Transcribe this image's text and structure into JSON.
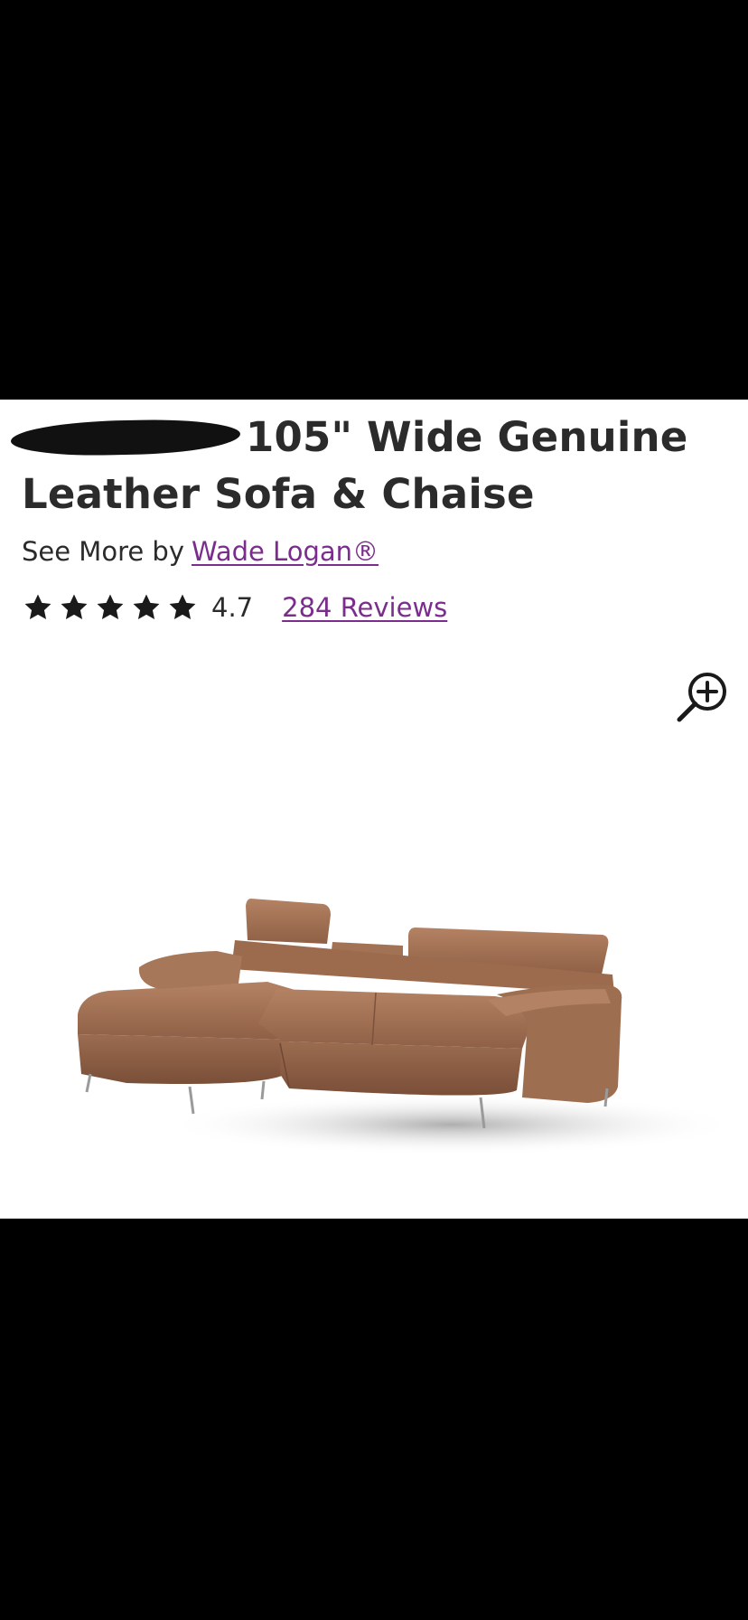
{
  "product": {
    "title_text": "105\" Wide Genuine Leather Sofa & Chaise",
    "see_more_prefix": "See More by",
    "brand": "Wade Logan®",
    "rating_value": "4.7",
    "rating_stars": 5,
    "reviews_link": "284 Reviews"
  },
  "icons": {
    "zoom": "zoom-in-icon",
    "star": "star-icon"
  },
  "colors": {
    "link": "#7b2d8e",
    "text": "#2b2b2b",
    "background": "#ffffff",
    "letterbox": "#000000"
  }
}
